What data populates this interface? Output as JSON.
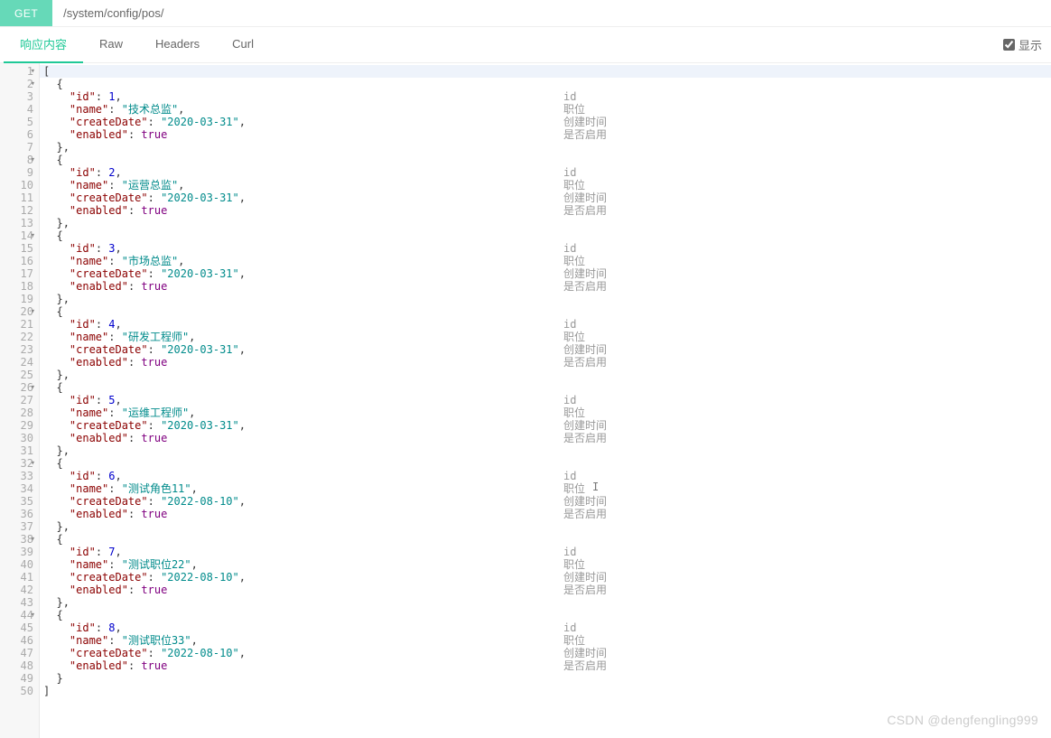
{
  "request": {
    "method": "GET",
    "url": "/system/config/pos/"
  },
  "tabs": {
    "items": [
      "响应内容",
      "Raw",
      "Headers",
      "Curl"
    ],
    "active_index": 0
  },
  "right_control": {
    "checked": true,
    "label": "显示"
  },
  "json_keys": {
    "id": "id",
    "name": "name",
    "createDate": "createDate",
    "enabled": "enabled"
  },
  "annotations": {
    "id": "id",
    "name": "职位",
    "createDate": "创建时间",
    "enabled": "是否启用"
  },
  "cursor_at_line": 34,
  "response_body": [
    {
      "id": 1,
      "name": "技术总监",
      "createDate": "2020-03-31",
      "enabled": true
    },
    {
      "id": 2,
      "name": "运营总监",
      "createDate": "2020-03-31",
      "enabled": true
    },
    {
      "id": 3,
      "name": "市场总监",
      "createDate": "2020-03-31",
      "enabled": true
    },
    {
      "id": 4,
      "name": "研发工程师",
      "createDate": "2020-03-31",
      "enabled": true
    },
    {
      "id": 5,
      "name": "运维工程师",
      "createDate": "2020-03-31",
      "enabled": true
    },
    {
      "id": 6,
      "name": "测试角色11",
      "createDate": "2022-08-10",
      "enabled": true
    },
    {
      "id": 7,
      "name": "测试职位22",
      "createDate": "2022-08-10",
      "enabled": true
    },
    {
      "id": 8,
      "name": "测试职位33",
      "createDate": "2022-08-10",
      "enabled": true
    }
  ],
  "watermark": "CSDN @dengfengling999"
}
